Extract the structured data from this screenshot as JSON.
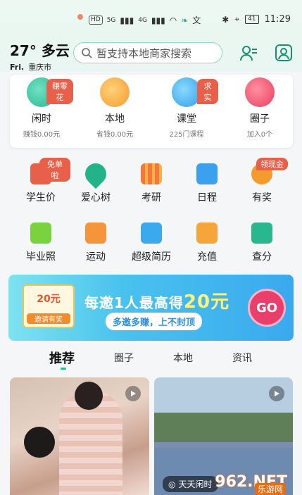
{
  "status_bar": {
    "network": "HD",
    "signal1": "5G",
    "signal2": "4G",
    "battery": "41",
    "time": "11:29"
  },
  "header": {
    "temperature": "27°",
    "weather": "多云",
    "day": "Fri.",
    "city": "重庆市",
    "search_placeholder": "暂支持本地商家搜索"
  },
  "top_card": [
    {
      "title": "闲时",
      "sub": "赚钱0.00元",
      "tag": "赚零花",
      "icon": "clock-icon",
      "color": "#38c9a5"
    },
    {
      "title": "本地",
      "sub": "省钱0.00元",
      "tag": "",
      "icon": "location-pin-icon",
      "color": "#f7a93c"
    },
    {
      "title": "课堂",
      "sub": "225门课程",
      "tag": "求实",
      "icon": "play-icon",
      "color": "#3bb3ee"
    },
    {
      "title": "圈子",
      "sub": "加入0个",
      "tag": "",
      "icon": "chat-bubble-icon",
      "color": "#f2566f"
    }
  ],
  "grid": [
    {
      "label": "学生价",
      "tag": "免单啦",
      "icon": "price-tag-icon",
      "color": "#e8604a"
    },
    {
      "label": "爱心树",
      "tag": "",
      "icon": "leaf-icon",
      "color": "#22b38a"
    },
    {
      "label": "考研",
      "tag": "",
      "icon": "books-icon",
      "color": "#f2783b"
    },
    {
      "label": "日程",
      "tag": "",
      "icon": "printer-icon",
      "color": "#3ba0ee"
    },
    {
      "label": "有奖",
      "tag": "领现金",
      "icon": "coins-icon",
      "color": "#f49b2d"
    },
    {
      "label": "毕业照",
      "tag": "",
      "icon": "camera-icon",
      "color": "#7ad23e"
    },
    {
      "label": "运动",
      "tag": "",
      "icon": "sneaker-icon",
      "color": "#f5943a"
    },
    {
      "label": "超级简历",
      "tag": "",
      "icon": "notebook-icon",
      "color": "#3ba9ee"
    },
    {
      "label": "充值",
      "tag": "",
      "icon": "phone-recharge-icon",
      "color": "#f6a53a"
    },
    {
      "label": "查分",
      "tag": "",
      "icon": "bar-chart-icon",
      "color": "#28b78f"
    }
  ],
  "banner": {
    "coupon_amount": "20元",
    "coupon_label": "邀请有奖",
    "headline": "每邀1人最高得",
    "headline_amount": "20元",
    "sub": "多邀多赚，上不封顶",
    "go": "GO"
  },
  "tabs": [
    "推荐",
    "圈子",
    "本地",
    "资讯"
  ],
  "feed": {
    "right_caption": "天天闲时",
    "watermark": "962.NET",
    "watermark_sub": "乐游网"
  }
}
